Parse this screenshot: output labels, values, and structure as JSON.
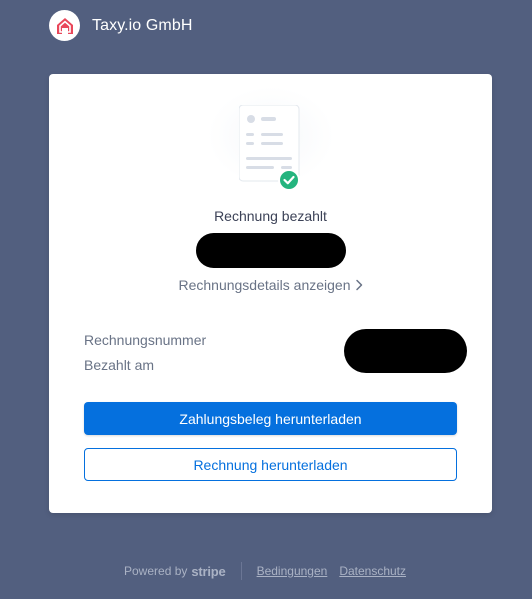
{
  "header": {
    "company_name": "Taxy.io GmbH",
    "logo_icon": "house-icon",
    "logo_color": "#e9475a"
  },
  "card": {
    "status_title": "Rechnung bezahlt",
    "details_link": "Rechnungsdetails anzeigen",
    "fields": {
      "invoice_number_label": "Rechnungsnummer",
      "paid_on_label": "Bezahlt am"
    },
    "buttons": {
      "download_receipt": "Zahlungsbeleg herunterladen",
      "download_invoice": "Rechnung herunterladen"
    }
  },
  "footer": {
    "powered_by": "Powered by",
    "brand": "stripe",
    "terms": "Bedingungen",
    "privacy": "Datenschutz"
  },
  "colors": {
    "background": "#525f7f",
    "primary": "#0570de",
    "success": "#24b47e"
  }
}
